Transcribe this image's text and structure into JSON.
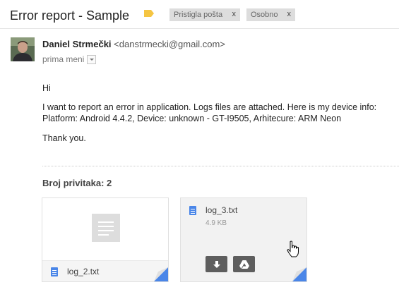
{
  "email": {
    "subject": "Error report - Sample",
    "labels": [
      {
        "name": "Pristigla pošta",
        "remove": "x"
      },
      {
        "name": "Osobno",
        "remove": "x"
      }
    ],
    "label_tag_color": "#f5c542",
    "sender": {
      "name": "Daniel Strmečki",
      "email": "<danstrmecki@gmail.com>"
    },
    "recipient_text": "prima meni",
    "body": {
      "greeting": "Hi",
      "paragraph": "I want to report an error in application. Logs files are attached. Here is my device info: Platform: Android 4.4.2, Device: unknown - GT-I9505, Arhitecure: ARM Neon",
      "closing": "Thank you."
    }
  },
  "attachments": {
    "count_label": "Broj privitaka: 2",
    "files": [
      {
        "name": "log_2.txt",
        "icon": "text-file-icon"
      },
      {
        "name": "log_3.txt",
        "size": "4.9 KB",
        "icon": "text-file-icon"
      }
    ],
    "actions": [
      "download-icon",
      "drive-icon"
    ]
  },
  "colors": {
    "accent_blue": "#4a86e8",
    "button_gray": "#5e5e5e",
    "chip_bg": "#dddddd"
  }
}
